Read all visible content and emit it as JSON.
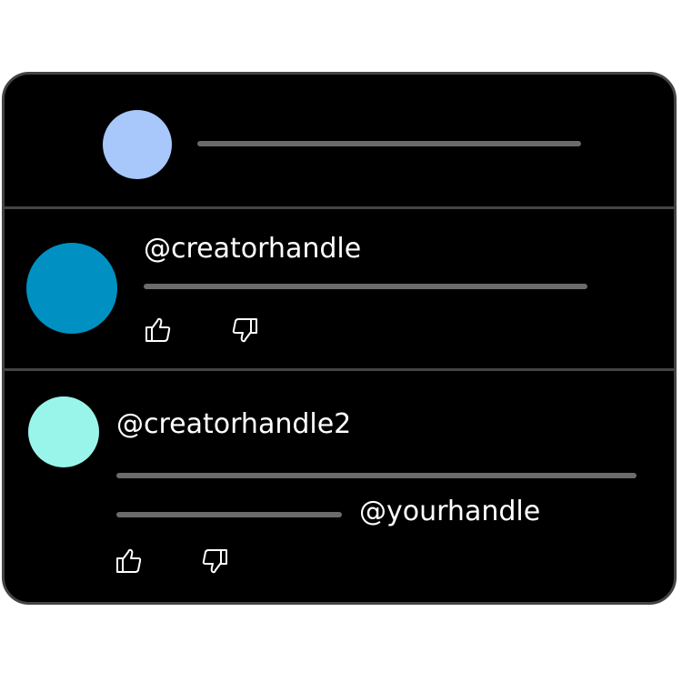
{
  "colors": {
    "card_bg": "#000000",
    "card_border": "#444444",
    "placeholder_line": "#6b6b6b",
    "avatar_composer": "#a8c7fa",
    "avatar_comment_1": "#0091c2",
    "avatar_comment_2": "#99f5ea",
    "text": "#ffffff"
  },
  "composer": {
    "avatar_icon": "user-avatar"
  },
  "comments": [
    {
      "handle": "@creatorhandle",
      "like_icon": "thumbs-up-icon",
      "dislike_icon": "thumbs-down-icon"
    },
    {
      "handle": "@creatorhandle2",
      "mention": "@yourhandle",
      "like_icon": "thumbs-up-icon",
      "dislike_icon": "thumbs-down-icon"
    }
  ]
}
